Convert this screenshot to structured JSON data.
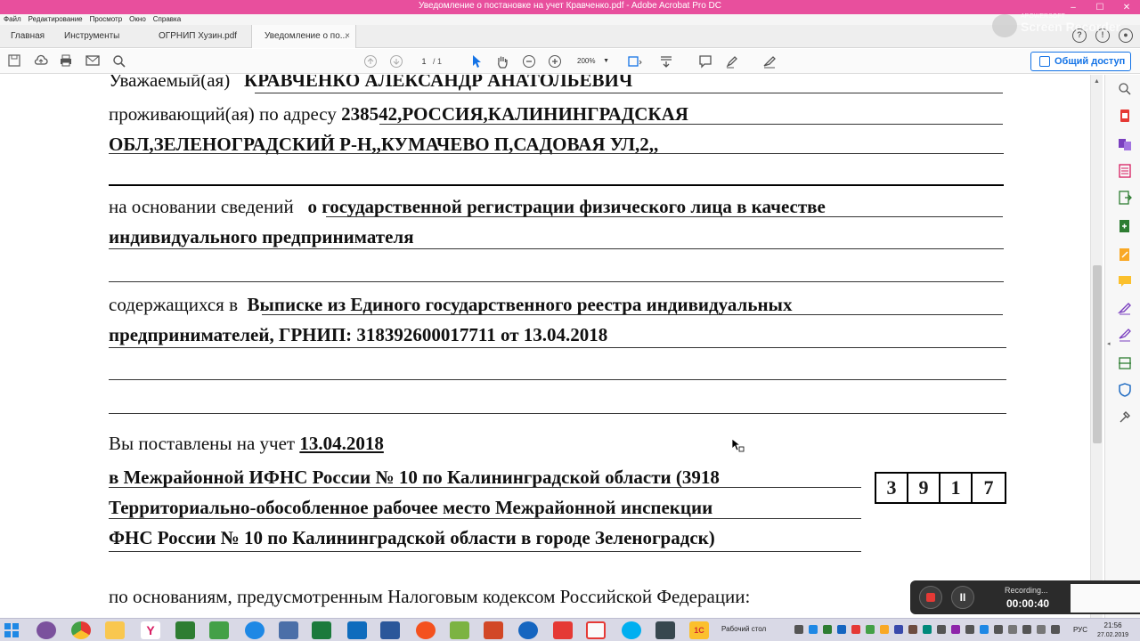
{
  "window": {
    "title": "Уведомление о постановке на учет Кравченко.pdf - Adobe Acrobat Pro DC",
    "controls": [
      "–",
      "☐",
      "✕"
    ]
  },
  "menu": [
    "Файл",
    "Редактирование",
    "Просмотр",
    "Окно",
    "Справка"
  ],
  "tabs": [
    {
      "label": "Главная"
    },
    {
      "label": "Инструменты"
    },
    {
      "label": "ОГРНИП Хузин.pdf"
    },
    {
      "label": "Уведомление о по...",
      "close": "×"
    }
  ],
  "watermark": {
    "small": "APOWERSOFT",
    "big": "Screen Recorder"
  },
  "toolbar": {
    "page_current": "1",
    "page_total": "/ 1",
    "zoom": "200%",
    "share_label": "Общий доступ"
  },
  "document": {
    "line1_prefix": "Уважаемый(ая)",
    "line1_value": "КРАВЧЕНКО АЛЕКСАНДР АНАТОЛЬЕВИЧ",
    "line2_prefix": "проживающий(ая) по адресу",
    "line2_value": "238542,РОССИЯ,КАЛИНИНГРАДСКАЯ",
    "line3_value": "ОБЛ,ЗЕЛЕНОГРАДСКИЙ Р-Н,,КУМАЧЕВО П,САДОВАЯ УЛ,2,,",
    "line4_prefix": "на основании сведений",
    "line4_value": "о государственной регистрации физического лица в качестве",
    "line5_value": "индивидуального предпринимателя",
    "line6_prefix": "содержащихся в",
    "line6_value": "Выписке из Единого государственного реестра индивидуальных",
    "line7_value": "предпринимателей, ГРНИП: 318392600017711 от 13.04.2018",
    "line8_prefix": "Вы поставлены на учет",
    "line8_value": "13.04.2018",
    "line9_value": "в Межрайонной ИФНС России № 10 по Калининградской области (3918",
    "line10_value": "Территориально-обособленное рабочее место Межрайонной инспекции",
    "line11_value": "ФНС России № 10 по Калининградской области в городе Зеленоградск)",
    "line12_text": "по основаниям, предусмотренным Налоговым кодексом Российской Федерации:",
    "code_digits": [
      "3",
      "9",
      "1",
      "7"
    ]
  },
  "recorder": {
    "status": "Recording...",
    "time": "00:00:40"
  },
  "taskbar": {
    "desktop_label": "Рабочий стол",
    "language": "РУС",
    "time": "21:56",
    "date": "27.02.2019"
  },
  "colors": {
    "titlebar": "#e84f9d",
    "accent": "#1473e6",
    "recorder_stop": "#e53935"
  }
}
